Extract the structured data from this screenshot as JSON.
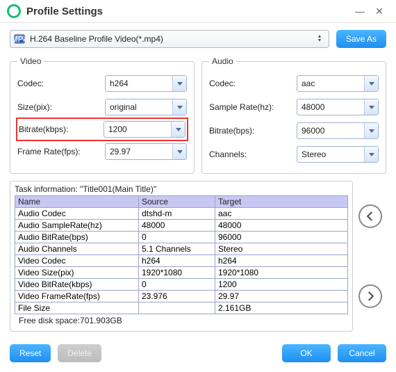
{
  "title": "Profile Settings",
  "profile_selected": "H.264 Baseline Profile Video(*.mp4)",
  "save_as_label": "Save As",
  "video": {
    "legend": "Video",
    "codec_label": "Codec:",
    "codec_value": "h264",
    "size_label": "Size(pix):",
    "size_value": "original",
    "bitrate_label": "Bitrate(kbps):",
    "bitrate_value": "1200",
    "framerate_label": "Frame Rate(fps):",
    "framerate_value": "29.97"
  },
  "audio": {
    "legend": "Audio",
    "codec_label": "Codec:",
    "codec_value": "aac",
    "samplerate_label": "Sample Rate(hz):",
    "samplerate_value": "48000",
    "bitrate_label": "Bitrate(bps):",
    "bitrate_value": "96000",
    "channels_label": "Channels:",
    "channels_value": "Stereo"
  },
  "task": {
    "header": "Task information: \"Title001(Main Title)\"",
    "cols": {
      "name": "Name",
      "source": "Source",
      "target": "Target"
    },
    "free_disk": "Free disk space:701.903GB",
    "rows": [
      {
        "name": "Audio Codec",
        "source": "dtshd-m",
        "target": "aac"
      },
      {
        "name": "Audio SampleRate(hz)",
        "source": "48000",
        "target": "48000"
      },
      {
        "name": "Audio BitRate(bps)",
        "source": "0",
        "target": "96000"
      },
      {
        "name": "Audio Channels",
        "source": "5.1 Channels",
        "target": "Stereo"
      },
      {
        "name": "Video Codec",
        "source": "h264",
        "target": "h264"
      },
      {
        "name": "Video Size(pix)",
        "source": "1920*1080",
        "target": "1920*1080"
      },
      {
        "name": "Video BitRate(kbps)",
        "source": "0",
        "target": "1200"
      },
      {
        "name": "Video FrameRate(fps)",
        "source": "23.976",
        "target": "29.97"
      },
      {
        "name": "File Size",
        "source": "",
        "target": "2.161GB"
      }
    ]
  },
  "buttons": {
    "reset": "Reset",
    "delete": "Delete",
    "ok": "OK",
    "cancel": "Cancel"
  }
}
